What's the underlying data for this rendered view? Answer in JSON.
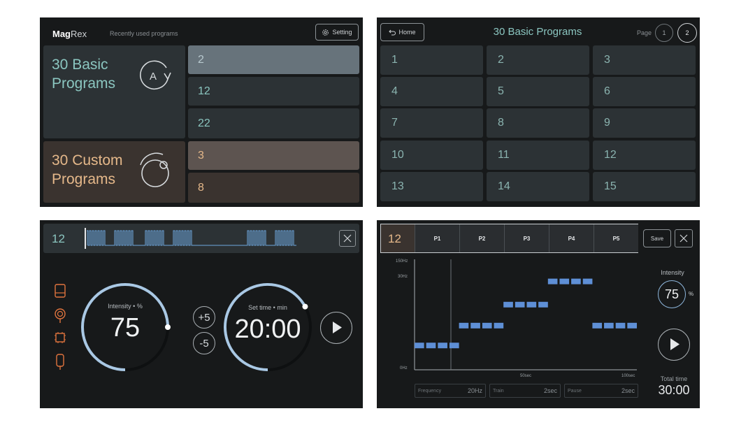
{
  "panel1": {
    "logo_bold": "Mag",
    "logo_rest": "Rex",
    "recent_label": "Recently used programs",
    "setting_label": "Setting",
    "basic_title_line1": "30 Basic",
    "basic_title_line2": "Programs",
    "basic_icon_letter": "A",
    "custom_title_line1": "30 Custom",
    "custom_title_line2": "Programs",
    "recent_basic": [
      "2",
      "12",
      "22"
    ],
    "recent_custom": [
      "3",
      "8"
    ],
    "colors": {
      "basic_accent": "#8bc6c0",
      "custom_accent": "#e5b88a",
      "selected_basic": "#67737b",
      "selected_custom": "#5d5450"
    }
  },
  "panel2": {
    "home_label": "Home",
    "title": "30 Basic Programs",
    "page_label": "Page",
    "pages": [
      "1",
      "2"
    ],
    "programs": [
      "1",
      "2",
      "3",
      "4",
      "5",
      "6",
      "7",
      "8",
      "9",
      "10",
      "11",
      "12",
      "13",
      "14",
      "15"
    ]
  },
  "panel3": {
    "program_number": "12",
    "intensity_label": "Intensity • %",
    "intensity_value": "75",
    "plus_label": "+5",
    "minus_label": "-5",
    "time_label": "Set time • min",
    "time_value": "20:00",
    "intensity_level": 0.75,
    "time_level": 0.67,
    "side_icons": [
      "coil-icon",
      "target-coil-icon",
      "chip-icon",
      "handheld-coil-icon"
    ]
  },
  "panel4": {
    "program_number": "12",
    "phases": [
      "P1",
      "P2",
      "P3",
      "P4",
      "P5"
    ],
    "save_label": "Save",
    "y_labels": [
      "150Hz",
      "30Hz",
      "0Hz"
    ],
    "x_labels": [
      "50sec",
      "100sec"
    ],
    "intensity_label": "Intensity",
    "intensity_value": "75",
    "intensity_unit": "%",
    "total_time_label": "Total time",
    "total_time_value": "30:00",
    "fields": [
      {
        "label": "Frequency",
        "value": "20Hz"
      },
      {
        "label": "Train",
        "value": "2sec"
      },
      {
        "label": "Pause",
        "value": "2sec"
      }
    ]
  },
  "chart_data": {
    "type": "line",
    "title": "",
    "xlabel": "",
    "ylabel": "",
    "x_ticks": [
      "50sec",
      "100sec"
    ],
    "y_ticks": [
      "0Hz",
      "30Hz",
      "150Hz"
    ],
    "series": [
      {
        "values": [
          {
            "x": [
              0,
              20
            ],
            "y": 0.22
          },
          {
            "x": [
              20,
              40
            ],
            "y": 0.4
          },
          {
            "x": [
              40,
              60
            ],
            "y": 0.59
          },
          {
            "x": [
              60,
              80
            ],
            "y": 0.8
          },
          {
            "x": [
              80,
              100
            ],
            "y": 0.4
          }
        ]
      }
    ],
    "color": "#5e8fd6"
  }
}
